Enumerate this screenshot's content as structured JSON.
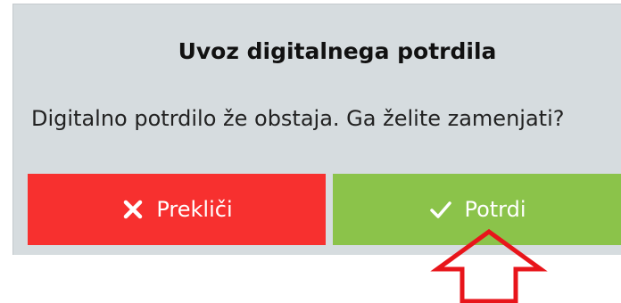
{
  "dialog": {
    "title": "Uvoz digitalnega potrdila",
    "message": "Digitalno potrdilo že obstaja. Ga želite zamenjati?",
    "cancel_label": "Prekliči",
    "confirm_label": "Potrdi",
    "cancel_icon": "close-icon",
    "confirm_icon": "check-icon"
  },
  "colors": {
    "dialog_background": "#d6dcdf",
    "cancel_button": "#f7302f",
    "confirm_button": "#8bc34a",
    "annotation_arrow": "#e8151b"
  }
}
